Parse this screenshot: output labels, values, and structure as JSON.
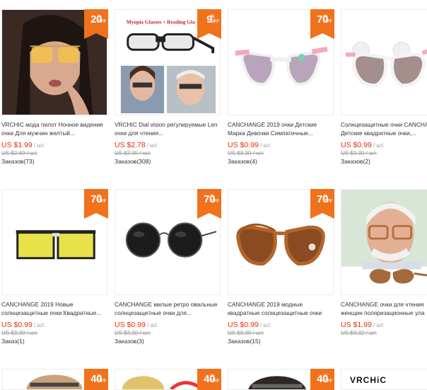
{
  "products": [
    {
      "title": [
        "VRCHIC мода пилот Ночное видение",
        "очки Для мужчин желтый..."
      ],
      "price": "US $1.99",
      "unit": " / шт.",
      "old_price": "US $2.49 / шт.",
      "orders": "Заказов(73)",
      "discount": "20"
    },
    {
      "title": [
        "VRCHIC Dial vision регулируемые Len",
        "очки для чтения..."
      ],
      "price": "US $2.78",
      "unit": " / шт.",
      "old_price": "US $3.05 / шт.",
      "orders": "Заказов(308)",
      "discount": "9",
      "image_text": "Myopia Glasses + Reading Gla"
    },
    {
      "title": [
        "CANCHANGE 2019 очки Детские",
        "Марка Девочки Симпатичные..."
      ],
      "price": "US $0.99",
      "unit": " / шт.",
      "old_price": "US $3.30 / шт.",
      "orders": "Заказов(4)",
      "discount": "70"
    },
    {
      "title": [
        "Солнцезащитные очки CANCHA",
        "Детские квадратные очки,..."
      ],
      "price": "US $0.99",
      "unit": " / шт.",
      "old_price": "US $3.30 / шт.",
      "orders": "Заказов(2)",
      "discount": "70"
    },
    {
      "title": [
        "CANCHANGE 2019 Новые",
        "солнцезащитные очки Квадратные..."
      ],
      "price": "US $0.99",
      "unit": " / шт.",
      "old_price": "US $3.30 / шт.",
      "orders": "Заказ(1)",
      "discount": "70"
    },
    {
      "title": [
        "CANCHANGE милые ретро овальные",
        "солнцезащитные очки для..."
      ],
      "price": "US $0.99",
      "unit": " / шт.",
      "old_price": "US $3.30 / шт.",
      "orders": "Заказов(3)",
      "discount": "70"
    },
    {
      "title": [
        "CANCHANGE 2019 модные",
        "квадратные солнцезащитные очки"
      ],
      "price": "US $0.99",
      "unit": " / шт.",
      "old_price": "US $3.30 / шт.",
      "orders": "Заказов(15)",
      "discount": "70"
    },
    {
      "title": [
        "CANCHANGE очки для чтения",
        "женщин поляризационные ула"
      ],
      "price": "US $1.99",
      "unit": " / шт.",
      "old_price": "US $3.32 / шт.",
      "orders": "",
      "discount": ""
    }
  ],
  "row3": [
    {
      "discount": "40"
    },
    {
      "discount": "40"
    },
    {
      "discount": "40"
    },
    {
      "brand": "VRCHiC"
    }
  ],
  "badge_suffix": "%",
  "badge_off": "OFF",
  "colors": {
    "accent": "#f0721d",
    "price": "#e62e04"
  }
}
